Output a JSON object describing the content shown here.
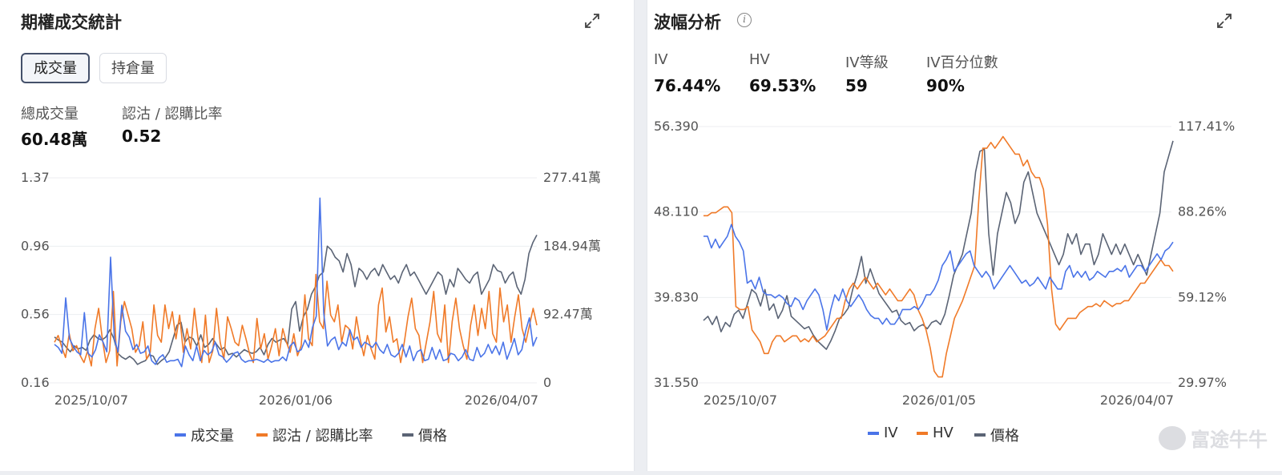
{
  "left": {
    "title": "期權成交統計",
    "tabs": [
      {
        "label": "成交量",
        "active": true
      },
      {
        "label": "持倉量",
        "active": false
      }
    ],
    "stats": [
      {
        "label": "總成交量",
        "value": "60.48萬"
      },
      {
        "label": "認沽 / 認購比率",
        "value": "0.52"
      }
    ]
  },
  "right": {
    "title": "波幅分析",
    "stats": [
      {
        "label": "IV",
        "value": "76.44%"
      },
      {
        "label": "HV",
        "value": "69.53%"
      },
      {
        "label": "IV等級",
        "value": "59"
      },
      {
        "label": "IV百分位數",
        "value": "90%"
      }
    ]
  },
  "watermark": "富途牛牛",
  "colors": {
    "blue": "#4a74e8",
    "orange": "#f07a28",
    "gray": "#5b6475"
  },
  "chart_data": [
    {
      "type": "line",
      "x_tick_labels": [
        "2025/10/07",
        "2026/01/06",
        "2026/04/07"
      ],
      "left_axis_ticks": [
        "1.37",
        "0.96",
        "0.56",
        "0.16"
      ],
      "right_axis_ticks": [
        "277.41萬",
        "184.94萬",
        "92.47萬",
        "0"
      ],
      "ylim_left": [
        0.16,
        1.37
      ],
      "ylim_right": [
        0,
        277.41
      ],
      "grid": true,
      "legend_position": "bottom",
      "series": [
        {
          "name": "成交量",
          "color": "#4a74e8",
          "axis": "right",
          "values": [
            52,
            48,
            40,
            115,
            60,
            50,
            42,
            38,
            95,
            40,
            35,
            45,
            65,
            55,
            42,
            170,
            60,
            42,
            105,
            70,
            62,
            45,
            52,
            40,
            42,
            50,
            30,
            25,
            34,
            38,
            28,
            30,
            30,
            32,
            22,
            50,
            38,
            30,
            50,
            30,
            44,
            38,
            42,
            55,
            38,
            35,
            28,
            33,
            40,
            42,
            32,
            28,
            30,
            30,
            32,
            30,
            28,
            32,
            28,
            30,
            30,
            35,
            30,
            50,
            55,
            42,
            45,
            58,
            48,
            75,
            90,
            250,
            95,
            50,
            58,
            62,
            45,
            55,
            50,
            72,
            58,
            62,
            48,
            55,
            52,
            48,
            55,
            45,
            40,
            52,
            38,
            35,
            40,
            52,
            35,
            50,
            30,
            42,
            45,
            30,
            32,
            48,
            32,
            45,
            30,
            32,
            40,
            38,
            30,
            35,
            45,
            32,
            30,
            48,
            35,
            40,
            52,
            40,
            50,
            38,
            55,
            32,
            45,
            60,
            38,
            45,
            70,
            88,
            50,
            62
          ]
        },
        {
          "name": "認沽 / 認購比率",
          "color": "#f07a28",
          "axis": "left",
          "values": [
            0.4,
            0.44,
            0.37,
            0.31,
            0.45,
            0.35,
            0.38,
            0.32,
            0.28,
            0.35,
            0.26,
            0.48,
            0.6,
            0.42,
            0.28,
            0.35,
            0.7,
            0.26,
            0.52,
            0.64,
            0.56,
            0.48,
            0.34,
            0.38,
            0.52,
            0.3,
            0.34,
            0.62,
            0.44,
            0.4,
            0.62,
            0.48,
            0.58,
            0.42,
            0.56,
            0.34,
            0.48,
            0.36,
            0.6,
            0.42,
            0.28,
            0.56,
            0.28,
            0.35,
            0.6,
            0.4,
            0.3,
            0.55,
            0.48,
            0.4,
            0.38,
            0.5,
            0.42,
            0.33,
            0.28,
            0.54,
            0.36,
            0.45,
            0.3,
            0.38,
            0.48,
            0.32,
            0.48,
            0.4,
            0.34,
            0.45,
            0.32,
            0.38,
            0.68,
            0.42,
            0.38,
            0.8,
            0.52,
            0.48,
            0.76,
            0.56,
            0.52,
            0.62,
            0.4,
            0.5,
            0.48,
            0.36,
            0.55,
            0.42,
            0.32,
            0.44,
            0.36,
            0.3,
            0.62,
            0.72,
            0.46,
            0.55,
            0.4,
            0.42,
            0.28,
            0.4,
            0.55,
            0.66,
            0.48,
            0.44,
            0.28,
            0.4,
            0.52,
            0.7,
            0.45,
            0.4,
            0.62,
            0.28,
            0.52,
            0.66,
            0.48,
            0.38,
            0.3,
            0.5,
            0.62,
            0.44,
            0.6,
            0.48,
            0.7,
            0.45,
            0.4,
            0.72,
            0.52,
            0.62,
            0.4,
            0.55,
            0.68,
            0.48,
            0.4,
            0.5,
            0.6,
            0.5
          ]
        },
        {
          "name": "價格",
          "color": "#5b6475",
          "axis": "right",
          "values": [
            62,
            58,
            55,
            48,
            42,
            50,
            46,
            48,
            44,
            58,
            65,
            60,
            58,
            62,
            72,
            60,
            40,
            35,
            32,
            36,
            32,
            25,
            28,
            30,
            38,
            36,
            25,
            30,
            34,
            42,
            60,
            78,
            82,
            55,
            62,
            60,
            50,
            65,
            48,
            52,
            60,
            52,
            45,
            48,
            38,
            40,
            35,
            40,
            45,
            42,
            40,
            42,
            48,
            38,
            52,
            60,
            55,
            58,
            60,
            52,
            100,
            110,
            70,
            90,
            100,
            120,
            130,
            145,
            150,
            185,
            180,
            170,
            165,
            150,
            175,
            160,
            130,
            155,
            150,
            140,
            150,
            155,
            145,
            160,
            150,
            140,
            145,
            135,
            150,
            160,
            145,
            150,
            140,
            130,
            120,
            130,
            140,
            150,
            145,
            120,
            140,
            130,
            155,
            148,
            140,
            135,
            145,
            150,
            120,
            130,
            140,
            160,
            152,
            150,
            135,
            145,
            150,
            130,
            120,
            140,
            175,
            190,
            200
          ]
        }
      ]
    },
    {
      "type": "line",
      "x_tick_labels": [
        "2025/10/07",
        "2026/01/05",
        "2026/04/07"
      ],
      "left_axis_ticks": [
        "56.390",
        "48.110",
        "39.830",
        "31.550"
      ],
      "right_axis_ticks": [
        "117.41%",
        "88.26%",
        "59.12%",
        "29.97%"
      ],
      "ylim_left": [
        31.55,
        56.39
      ],
      "ylim_right": [
        29.97,
        117.41
      ],
      "grid": true,
      "legend_position": "bottom",
      "series": [
        {
          "name": "IV",
          "color": "#4a74e8",
          "axis": "right",
          "values": [
            80,
            80,
            76,
            79,
            76,
            78,
            80,
            84,
            80,
            78,
            75,
            64,
            65,
            62,
            66,
            61,
            60,
            60,
            59,
            60,
            59,
            57,
            56,
            59,
            58,
            55,
            58,
            60,
            62,
            60,
            55,
            48,
            55,
            60,
            58,
            62,
            58,
            56,
            58,
            60,
            58,
            55,
            53,
            52,
            52,
            50,
            52,
            50,
            50,
            52,
            55,
            55,
            55,
            56,
            55,
            57,
            60,
            60,
            62,
            65,
            70,
            72,
            75,
            68,
            70,
            72,
            74,
            75,
            70,
            68,
            66,
            68,
            66,
            62,
            64,
            66,
            68,
            70,
            68,
            66,
            64,
            65,
            63,
            64,
            66,
            64,
            62,
            66,
            64,
            62,
            62,
            68,
            70,
            66,
            68,
            66,
            68,
            65,
            66,
            68,
            67,
            66,
            68,
            68,
            69,
            68,
            70,
            66,
            68,
            70,
            70,
            68,
            70,
            72,
            74,
            72,
            75,
            76,
            78
          ]
        },
        {
          "name": "HV",
          "color": "#f07a28",
          "axis": "right",
          "values": [
            87,
            87,
            88,
            88,
            89,
            90,
            90,
            88,
            56,
            55,
            55,
            56,
            48,
            46,
            44,
            40,
            40,
            44,
            46,
            46,
            44,
            45,
            46,
            46,
            44,
            45,
            44,
            46,
            44,
            45,
            46,
            48,
            50,
            52,
            52,
            58,
            62,
            64,
            62,
            64,
            66,
            64,
            62,
            64,
            62,
            60,
            62,
            60,
            58,
            58,
            60,
            62,
            60,
            55,
            52,
            48,
            42,
            34,
            32,
            32,
            40,
            46,
            52,
            55,
            58,
            62,
            66,
            70,
            92,
            110,
            110,
            112,
            110,
            112,
            114,
            112,
            110,
            108,
            108,
            104,
            106,
            102,
            100,
            100,
            96,
            84,
            62,
            50,
            48,
            50,
            52,
            52,
            52,
            54,
            55,
            56,
            56,
            57,
            56,
            58,
            57,
            56,
            57,
            57,
            58,
            58,
            60,
            62,
            64,
            64,
            66,
            68,
            70,
            72,
            70,
            70,
            68
          ]
        },
        {
          "name": "價格",
          "color": "#5b6475",
          "axis": "left",
          "values": [
            37.6,
            38.0,
            37.2,
            38.0,
            36.5,
            37.4,
            37.0,
            38.2,
            38.6,
            37.8,
            39.2,
            40.6,
            40.2,
            39.0,
            40.6,
            38.6,
            39.2,
            37.8,
            38.6,
            40.0,
            38.0,
            37.6,
            37.2,
            36.8,
            37.0,
            36.2,
            35.6,
            35.2,
            34.8,
            35.6,
            36.6,
            37.8,
            38.2,
            38.8,
            40.6,
            42.0,
            43.8,
            41.2,
            42.6,
            41.4,
            40.2,
            39.6,
            39.0,
            38.4,
            38.6,
            37.6,
            37.2,
            37.4,
            36.6,
            37.0,
            37.2,
            36.8,
            37.4,
            37.6,
            37.2,
            38.2,
            40.0,
            42.0,
            43.0,
            44.0,
            46.0,
            48.0,
            52.0,
            54.0,
            54.2,
            46.0,
            42.0,
            46.0,
            48.0,
            50.0,
            49.0,
            47.0,
            48.0,
            51.0,
            52.0,
            50.0,
            48.0,
            47.0,
            46.0,
            45.0,
            44.0,
            43.0,
            44.0,
            46.0,
            45.0,
            46.0,
            44.0,
            45.0,
            45.0,
            43.0,
            44.0,
            46.0,
            45.0,
            44.0,
            45.0,
            44.0,
            45.0,
            44.0,
            43.0,
            44.0,
            43.0,
            42.0,
            44.0,
            46.0,
            48.0,
            52.0,
            53.5,
            55.0
          ]
        }
      ]
    }
  ]
}
